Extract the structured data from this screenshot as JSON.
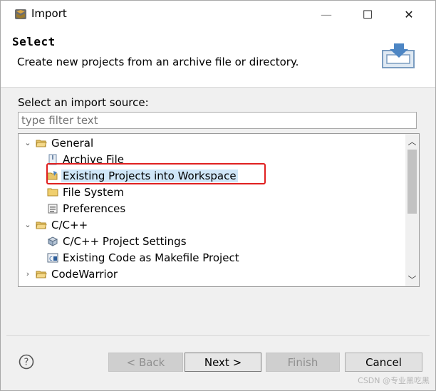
{
  "window": {
    "title": "Import",
    "controls": {
      "minimize": "—",
      "maximize": "☐",
      "close": "✕"
    }
  },
  "header": {
    "title": "Select",
    "description": "Create new projects from an archive file or directory."
  },
  "source": {
    "label": "Select an import source:",
    "filter_placeholder": "type filter text"
  },
  "tree": [
    {
      "label": "General",
      "level": 0,
      "expanded": true,
      "icon": "folder-open-icon"
    },
    {
      "label": "Archive File",
      "level": 1,
      "icon": "archive-file-icon"
    },
    {
      "label": "Existing Projects into Workspace",
      "level": 1,
      "icon": "projects-folder-icon",
      "selected": true,
      "highlighted": true
    },
    {
      "label": "File System",
      "level": 1,
      "icon": "folder-icon"
    },
    {
      "label": "Preferences",
      "level": 1,
      "icon": "preferences-icon"
    },
    {
      "label": "C/C++",
      "level": 0,
      "expanded": true,
      "icon": "folder-open-icon"
    },
    {
      "label": "C/C++ Project Settings",
      "level": 1,
      "icon": "project-settings-icon"
    },
    {
      "label": "Existing Code as Makefile Project",
      "level": 1,
      "icon": "makefile-project-icon"
    },
    {
      "label": "CodeWarrior",
      "level": 0,
      "expanded": false,
      "icon": "folder-open-icon"
    }
  ],
  "buttons": {
    "back": "< Back",
    "next": "Next >",
    "finish": "Finish",
    "cancel": "Cancel"
  },
  "watermark": "CSDN @专业黑吃黑",
  "colors": {
    "selection": "#cfe6f8",
    "highlight_box": "#e02020"
  }
}
